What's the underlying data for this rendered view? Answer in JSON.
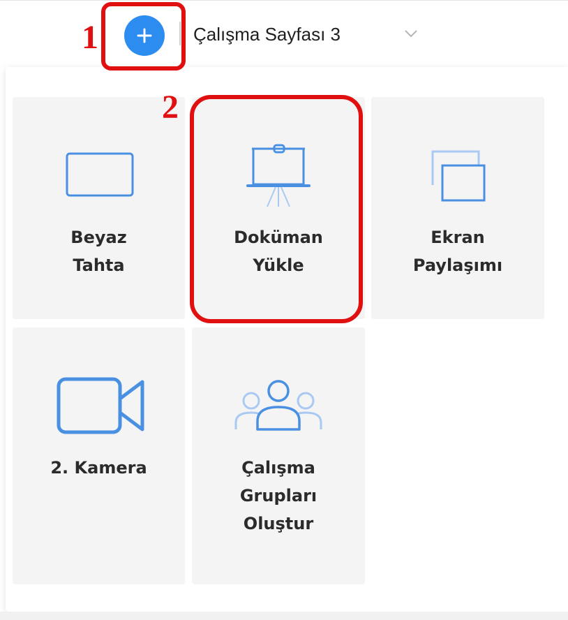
{
  "header": {
    "add_button_symbol": "+",
    "tab_title": "Çalışma Sayfası 3",
    "chevron_icon": "chevron-down-icon"
  },
  "tiles": {
    "whiteboard": {
      "line1": "Beyaz",
      "line2": "Tahta",
      "icon": "whiteboard-icon"
    },
    "upload_document": {
      "line1": "Doküman",
      "line2": "Yükle",
      "icon": "presentation-board-icon"
    },
    "screen_share": {
      "line1": "Ekran",
      "line2": "Paylaşımı",
      "icon": "screen-share-icon"
    },
    "second_camera": {
      "line1": "2. Kamera",
      "icon": "video-camera-icon"
    },
    "breakout_groups": {
      "line1": "Çalışma",
      "line2": "Grupları",
      "line3": "Oluştur",
      "icon": "people-group-icon"
    }
  },
  "annotations": {
    "step1": "1",
    "step2": "2"
  },
  "colors": {
    "accent": "#2d8cf0",
    "icon_blue": "#4a90e2",
    "icon_light": "#a9c9f2",
    "annotation_red": "#e01010",
    "tile_bg": "#f4f4f4"
  }
}
